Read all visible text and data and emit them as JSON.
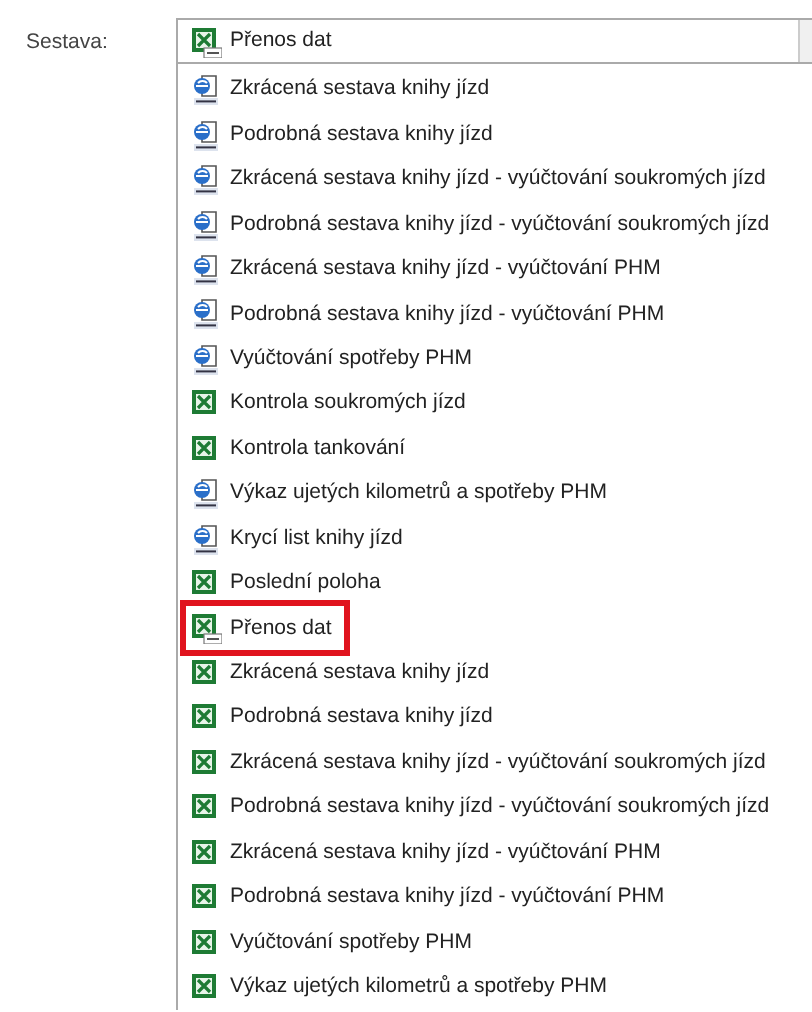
{
  "field": {
    "label": "Sestava:",
    "value": "Přenos dat",
    "kind": "csv"
  },
  "options": [
    {
      "label": "Zkrácená sestava knihy jízd",
      "kind": "html",
      "highlighted": false
    },
    {
      "label": "Podrobná sestava knihy jízd",
      "kind": "html",
      "highlighted": false
    },
    {
      "label": "Zkrácená sestava knihy jízd - vyúčtování soukromých jízd",
      "kind": "html",
      "highlighted": false
    },
    {
      "label": "Podrobná sestava knihy jízd - vyúčtování soukromých jízd",
      "kind": "html",
      "highlighted": false
    },
    {
      "label": "Zkrácená sestava knihy jízd - vyúčtování PHM",
      "kind": "html",
      "highlighted": false
    },
    {
      "label": "Podrobná sestava knihy jízd - vyúčtování PHM",
      "kind": "html",
      "highlighted": false
    },
    {
      "label": "Vyúčtování spotřeby PHM",
      "kind": "html",
      "highlighted": false
    },
    {
      "label": "Kontrola soukromých jízd",
      "kind": "xls",
      "highlighted": false
    },
    {
      "label": "Kontrola tankování",
      "kind": "xls",
      "highlighted": false
    },
    {
      "label": "Výkaz ujetých kilometrů a spotřeby PHM",
      "kind": "html",
      "highlighted": false
    },
    {
      "label": "Krycí list knihy jízd",
      "kind": "html",
      "highlighted": false
    },
    {
      "label": "Poslední poloha",
      "kind": "xls",
      "highlighted": false
    },
    {
      "label": "Přenos dat",
      "kind": "csv",
      "highlighted": true
    },
    {
      "label": "Zkrácená sestava knihy jízd",
      "kind": "xls",
      "highlighted": false
    },
    {
      "label": "Podrobná sestava knihy jízd",
      "kind": "xls",
      "highlighted": false
    },
    {
      "label": "Zkrácená sestava knihy jízd - vyúčtování soukromých jízd",
      "kind": "xls",
      "highlighted": false
    },
    {
      "label": "Podrobná sestava knihy jízd - vyúčtování soukromých jízd",
      "kind": "xls",
      "highlighted": false
    },
    {
      "label": "Zkrácená sestava knihy jízd - vyúčtování PHM",
      "kind": "xls",
      "highlighted": false
    },
    {
      "label": "Podrobná sestava knihy jízd - vyúčtování PHM",
      "kind": "xls",
      "highlighted": false
    },
    {
      "label": "Vyúčtování spotřeby PHM",
      "kind": "xls",
      "highlighted": false
    },
    {
      "label": "Výkaz ujetých kilometrů a spotřeby PHM",
      "kind": "xls",
      "highlighted": false
    }
  ]
}
